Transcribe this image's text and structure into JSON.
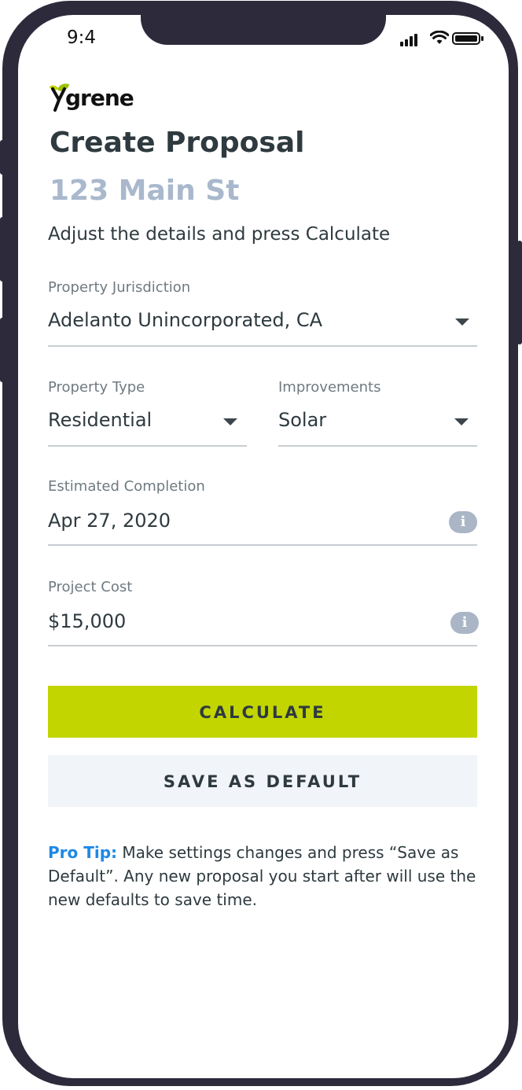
{
  "status_bar": {
    "time": "9:4"
  },
  "brand": {
    "logo_text": "grene",
    "logo_icon": "ygrene-leaf-logo",
    "accent_color": "#c2d500",
    "link_color": "#1e88e5"
  },
  "header": {
    "title": "Create Proposal",
    "address": "123 Main St",
    "instructions": "Adjust the details and press Calculate"
  },
  "form": {
    "jurisdiction": {
      "label": "Property Jurisdiction",
      "value": "Adelanto Unincorporated, CA"
    },
    "property_type": {
      "label": "Property Type",
      "value": "Residential"
    },
    "improvements": {
      "label": "Improvements",
      "value": "Solar"
    },
    "completion": {
      "label": "Estimated Completion",
      "value": "Apr 27, 2020",
      "info_icon": "info-icon"
    },
    "cost": {
      "label": "Project Cost",
      "value": "$15,000",
      "info_icon": "info-icon"
    }
  },
  "actions": {
    "calculate_label": "CALCULATE",
    "save_default_label": "SAVE AS DEFAULT"
  },
  "pro_tip": {
    "label": "Pro Tip:",
    "text": " Make settings changes and press “Save as Default”. Any new proposal you start after will use the new defaults to save time."
  }
}
